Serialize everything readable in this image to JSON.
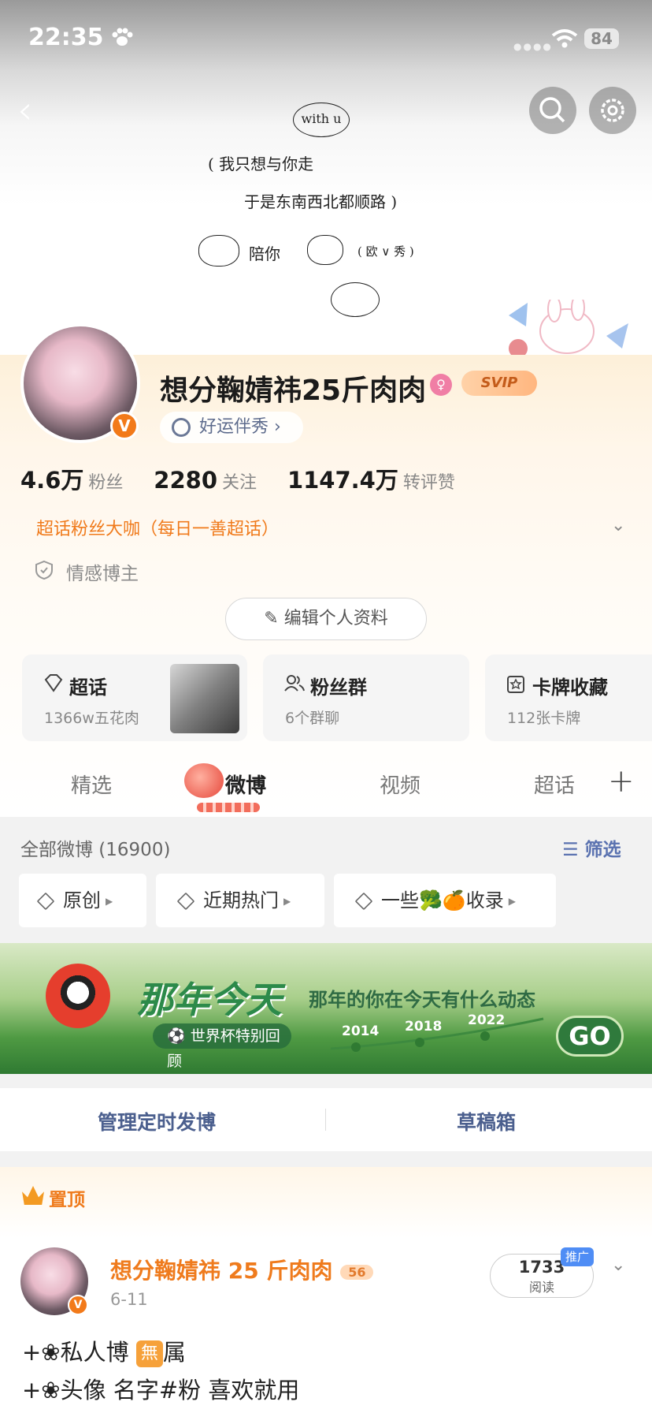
{
  "status_bar": {
    "time": "22:35",
    "battery": "84"
  },
  "cover": {
    "handwriting": [
      "with u",
      "( 我只想与你走",
      "于是东南西北都顺路 )",
      "陪你",
      "( 欧 ∨ 秀 )"
    ]
  },
  "profile": {
    "name": "想分鞠婧祎25斤肉肉",
    "svip_badge": "SVIP",
    "verified_badge": "V",
    "pill_label": "好运伴秀",
    "stats": [
      {
        "value": "4.6万",
        "label": "粉丝"
      },
      {
        "value": "2280",
        "label": "关注"
      },
      {
        "value": "1147.4万",
        "label": "转评赞"
      }
    ],
    "supertopic_title": "超话粉丝大咖（每日一善超话）",
    "blogger_tag": "情感博主",
    "edit_button": "编辑个人资料"
  },
  "cards": [
    {
      "title": "超话",
      "sub": "1366w五花肉"
    },
    {
      "title": "粉丝群",
      "sub": "6个群聊"
    },
    {
      "title": "卡牌收藏",
      "sub": "112张卡牌"
    }
  ],
  "tabs": [
    "精选",
    "微博",
    "视频",
    "超话"
  ],
  "feed": {
    "header": "全部微博 (16900)",
    "filter": "筛选",
    "chips": [
      "原创",
      "近期热门",
      "一些🥦🍊收录"
    ]
  },
  "banner": {
    "title": "那年今天",
    "subtitle": "那年的你在今天有什么动态",
    "chip": "⚽ 世界杯特别回顾",
    "years": [
      "2014",
      "2018",
      "2022"
    ],
    "go": "GO"
  },
  "actions": {
    "scheduled": "管理定时发博",
    "drafts": "草稿箱"
  },
  "post": {
    "pinned": "置顶",
    "author": "想分鞠婧祎 25 斤肉肉",
    "author_badge": "56",
    "date": "6-11",
    "reads": "1733",
    "reads_label": "阅读",
    "promo": "推广",
    "line1_prefix": "+❀私人博 ",
    "line1_box": "無",
    "line1_suffix": "属",
    "line2": "+❀头像 名字#粉 喜欢就用"
  },
  "colors": {
    "accent_orange": "#ef7b1d",
    "link_blue": "#5a72b0",
    "banner_green": "#2f7a3c"
  }
}
